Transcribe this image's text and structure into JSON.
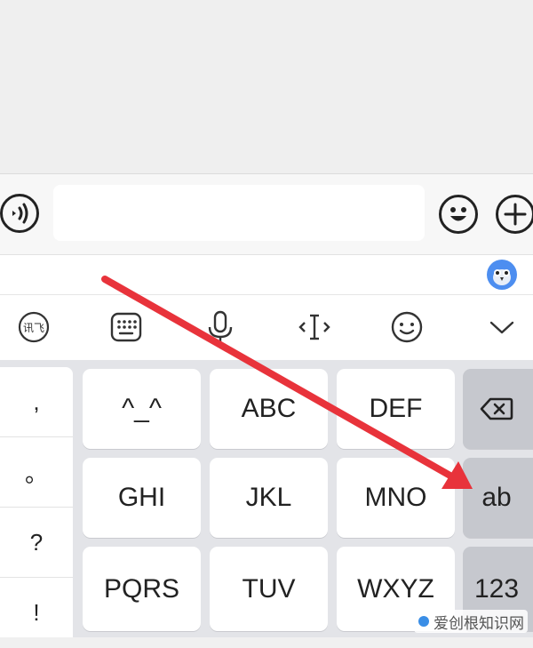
{
  "colors": {
    "arrow": "#e8333b",
    "key_bg": "#ffffff",
    "function_key_bg": "#c6c8ce",
    "keyboard_bg": "#e3e4e8",
    "mascot": "#4d8ef0"
  },
  "input_bar": {
    "voice_icon": "voice-waves-icon",
    "text_value": "",
    "emoji_icon": "smiley-icon",
    "plus_icon": "plus-icon"
  },
  "toolbar": {
    "items": [
      {
        "name": "xunfei-logo-icon",
        "glyph": "讯飞"
      },
      {
        "name": "keyboard-icon"
      },
      {
        "name": "microphone-icon"
      },
      {
        "name": "cursor-icon"
      },
      {
        "name": "emoji-icon"
      },
      {
        "name": "chevron-down-icon"
      }
    ]
  },
  "punctuation": [
    ",",
    "。",
    "?",
    "!"
  ],
  "keys": {
    "row1": [
      "^_^",
      "ABC",
      "DEF"
    ],
    "row2": [
      "GHI",
      "JKL",
      "MNO"
    ],
    "row3": [
      "PQRS",
      "TUV",
      "WXYZ"
    ],
    "backspace_icon": "backspace-icon",
    "ab": "ab",
    "num": "123"
  },
  "watermark": {
    "text": "爱创根知识网"
  }
}
